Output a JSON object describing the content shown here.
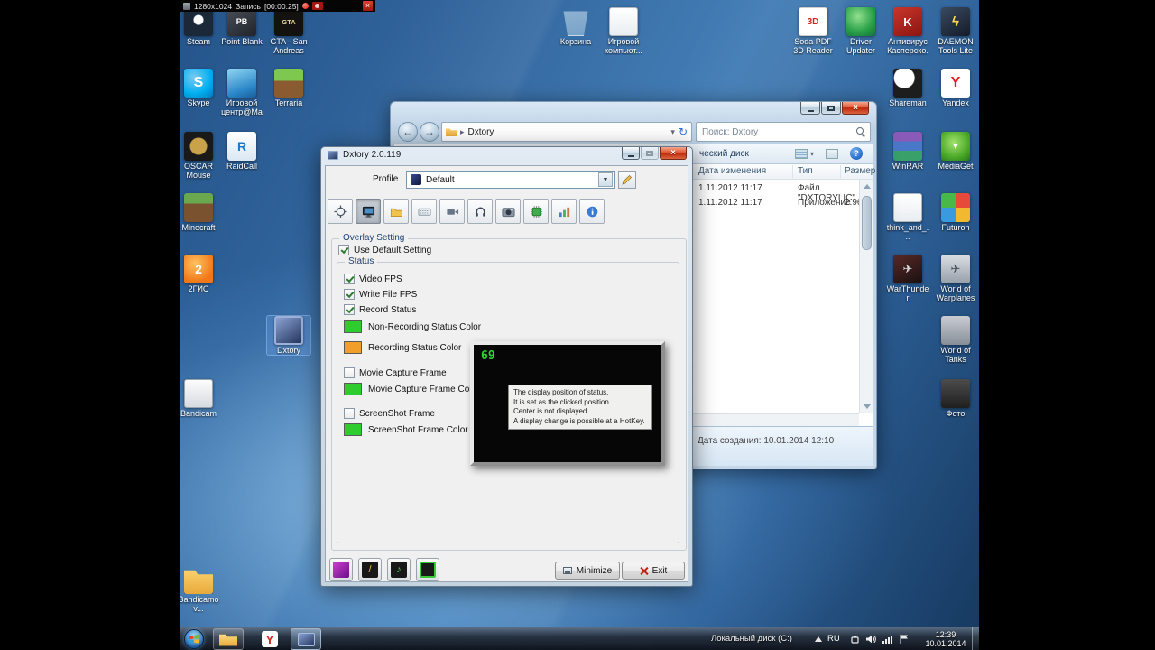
{
  "recording_bar": {
    "resolution": "1280x1024",
    "label": "Запись",
    "time": "[00:00.25]"
  },
  "desktop": {
    "left_icons": [
      {
        "label": "Steam",
        "glyph": ""
      },
      {
        "label": "Point Blank",
        "glyph": "PB"
      },
      {
        "label": "GTA - San Andreas",
        "glyph": "GTA"
      },
      {
        "label": "Skype",
        "glyph": "S"
      },
      {
        "label": "Игровой центр@Ma...",
        "glyph": ""
      },
      {
        "label": "Terraria",
        "glyph": ""
      },
      {
        "label": "OSCAR Mouse Scri...",
        "glyph": ""
      },
      {
        "label": "RaidCall",
        "glyph": "R"
      },
      {
        "label": "Minecraft",
        "glyph": ""
      },
      {
        "label": "2ГИС",
        "glyph": "2"
      },
      {
        "label": "Dxtory",
        "glyph": ""
      },
      {
        "label": "Bandicam",
        "glyph": ""
      },
      {
        "label": "Bandicamov...",
        "glyph": ""
      }
    ],
    "center_icons": [
      {
        "label": "Корзина",
        "glyph": ""
      },
      {
        "label": "Игровой компьют...",
        "glyph": ""
      }
    ],
    "right_icons": [
      {
        "label": "Soda PDF 3D Reader",
        "glyph": "3D"
      },
      {
        "label": "Driver Updater",
        "glyph": ""
      },
      {
        "label": "Антивирус Касперско...",
        "glyph": "K"
      },
      {
        "label": "DAEMON Tools Lite",
        "glyph": "ϟ"
      },
      {
        "label": "Shareman",
        "glyph": ""
      },
      {
        "label": "Yandex",
        "glyph": "Y"
      },
      {
        "label": "WinRAR",
        "glyph": ""
      },
      {
        "label": "MediaGet",
        "glyph": "▼"
      },
      {
        "label": "think_and_...",
        "glyph": ""
      },
      {
        "label": "Futuron",
        "glyph": ""
      },
      {
        "label": "WarThunder",
        "glyph": "✈"
      },
      {
        "label": "World of Warplanes",
        "glyph": "✈"
      },
      {
        "label": "World of Tanks",
        "glyph": ""
      },
      {
        "label": "Фото",
        "glyph": ""
      }
    ]
  },
  "explorer": {
    "address": "Dxtory",
    "search_placeholder": "Поиск: Dxtory",
    "command_bar_text": "ческий диск",
    "columns": {
      "modified": "Дата изменения",
      "type": "Тип",
      "size": "Размер"
    },
    "rows": [
      {
        "modified": "1.11.2012 11:17",
        "type": "Файл \"DXTORYLIC\"",
        "size": ""
      },
      {
        "modified": "1.11.2012 11:17",
        "type": "Приложение",
        "size": "2.96"
      }
    ],
    "details_created": "Дата создания: 10.01.2014 12:10"
  },
  "dxtory": {
    "title": "Dxtory 2.0.119",
    "profile": {
      "label": "Profile",
      "value": "Default"
    },
    "overlay": {
      "group": "Overlay Setting",
      "use_default": "Use Default Setting",
      "status_group": "Status",
      "video_fps": "Video FPS",
      "write_file_fps": "Write File FPS",
      "record_status": "Record Status",
      "non_recording_color_label": "Non-Recording Status Color",
      "recording_color_label": "Recording Status Color",
      "movie_frame_label": "Movie Capture Frame",
      "movie_frame_color_label": "Movie Capture Frame Color",
      "screenshot_frame_label": "ScreenShot Frame",
      "screenshot_frame_color_label": "ScreenShot Frame Color",
      "colors": {
        "non_recording": "#2ecc2e",
        "recording": "#f0a028",
        "movie_frame": "#2ecc2e",
        "screenshot_frame": "#2ecc2e"
      }
    },
    "preview": {
      "fps": "69",
      "tooltip": [
        "The display position of status.",
        "It is set as the clicked position.",
        "Center is not displayed.",
        "A display change is possible at a HotKey."
      ]
    },
    "buttons": {
      "minimize": "Minimize",
      "exit": "Exit"
    }
  },
  "taskbar": {
    "tray_text": "Локальный диск (C:)",
    "language": "RU",
    "time": "12:39",
    "date": "10.01.2014"
  }
}
